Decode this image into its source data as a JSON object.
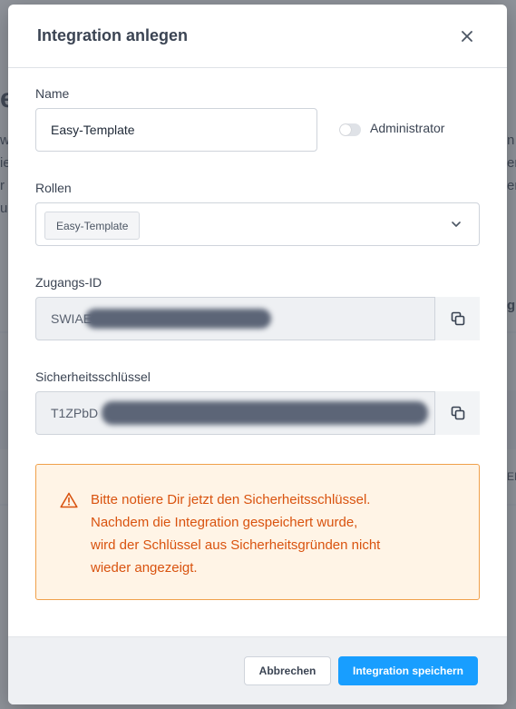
{
  "modal": {
    "title": "Integration anlegen"
  },
  "form": {
    "name_label": "Name",
    "name_value": "Easy-Template",
    "admin_toggle_label": "Administrator",
    "admin_toggle_on": false,
    "roles_label": "Rollen",
    "roles_selected": [
      "Easy-Template"
    ],
    "access_id_label": "Zugangs-ID",
    "access_id_value": "SWIAE",
    "secret_label": "Sicherheitsschlüssel",
    "secret_value": "T1ZPbD"
  },
  "warning": {
    "text": "Bitte notiere Dir jetzt den Sicherheitsschlüssel.\nNachdem die Integration gespeichert wurde,\nwird der Schlüssel aus Sicherheitsgründen nicht\nwieder angezeigt."
  },
  "footer": {
    "cancel_label": "Abbrechen",
    "save_label": "Integration speichern"
  },
  "colors": {
    "primary": "#189eff",
    "warning_text": "#d9530f",
    "warning_bg": "#fff4e6",
    "warning_border": "#f0a04b"
  },
  "background": {
    "fragments": [
      "e",
      "wa",
      "ie",
      "r",
      "u",
      "n",
      "er",
      "er",
      "g",
      "EM"
    ]
  }
}
